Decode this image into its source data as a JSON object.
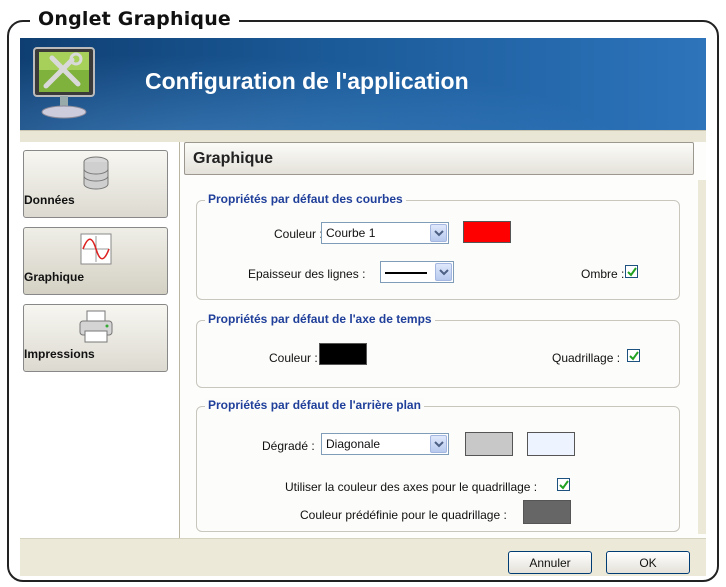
{
  "figure": {
    "caption": "Onglet Graphique"
  },
  "window": {
    "title": "Configuration de l'application"
  },
  "sidebar": {
    "items": [
      {
        "label": "Données",
        "icon": "database-icon"
      },
      {
        "label": "Graphique",
        "icon": "chart-icon",
        "active": true
      },
      {
        "label": "Impressions",
        "icon": "printer-icon"
      }
    ]
  },
  "panel": {
    "title": "Graphique",
    "curves": {
      "title": "Propriétés par défaut des courbes",
      "color_label": "Couleur :",
      "color_select_value": "Courbe 1",
      "color_swatch": "#ff0000",
      "thickness_label": "Epaisseur des lignes :",
      "shadow_label": "Ombre :",
      "shadow_checked": true
    },
    "time_axis": {
      "title": "Propriétés par défaut de l'axe de temps",
      "color_label": "Couleur :",
      "color_swatch": "#000000",
      "grid_label": "Quadrillage :",
      "grid_checked": true
    },
    "background": {
      "title": "Propriétés par défaut de l'arrière plan",
      "gradient_label": "Dégradé :",
      "gradient_select_value": "Diagonale",
      "gradient_color_1": "#c8c8c8",
      "gradient_color_2": "#eef4ff",
      "use_axis_color_label": "Utiliser la couleur des axes pour le quadrillage :",
      "use_axis_color_checked": true,
      "predefined_grid_color_label": "Couleur prédéfinie pour le quadrillage :",
      "predefined_grid_color": "#666666"
    }
  },
  "footer": {
    "cancel_label": "Annuler",
    "ok_label": "OK"
  }
}
